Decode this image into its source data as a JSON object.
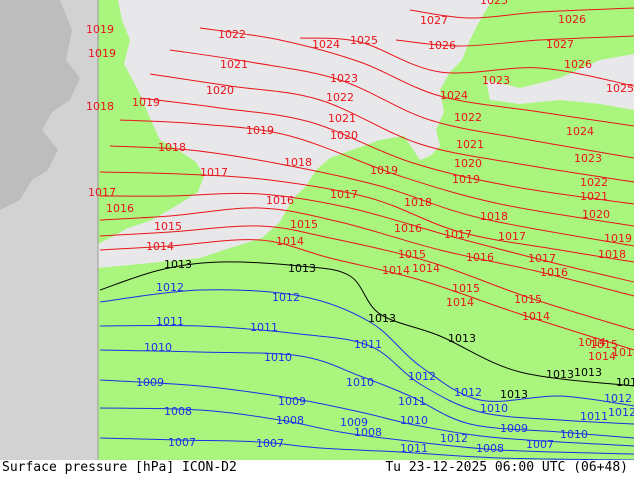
{
  "footer": {
    "left": "Surface pressure [hPa] ICON-D2",
    "right": "Tu 23-12-2025 06:00 UTC (06+48)"
  },
  "colors": {
    "sea": "#e8e8ea",
    "land_in_domain": "#aaf57e",
    "land_outside": "#bdbdbd",
    "sea_outside": "#d2d2d2",
    "isobar_high": "#e8141a",
    "isobar_low": "#1f2ee8",
    "isobar_1013": "#000000"
  },
  "isobars": [
    {
      "value": "1027",
      "color": "red"
    },
    {
      "value": "1026",
      "color": "red"
    },
    {
      "value": "1025",
      "color": "red"
    },
    {
      "value": "1024",
      "color": "red"
    },
    {
      "value": "1023",
      "color": "red"
    },
    {
      "value": "1022",
      "color": "red"
    },
    {
      "value": "1021",
      "color": "red"
    },
    {
      "value": "1020",
      "color": "red"
    },
    {
      "value": "1019",
      "color": "red"
    },
    {
      "value": "1018",
      "color": "red"
    },
    {
      "value": "1017",
      "color": "red"
    },
    {
      "value": "1016",
      "color": "red"
    },
    {
      "value": "1015",
      "color": "red"
    },
    {
      "value": "1014",
      "color": "red"
    },
    {
      "value": "1013",
      "color": "black"
    },
    {
      "value": "1012",
      "color": "blue"
    },
    {
      "value": "1011",
      "color": "blue"
    },
    {
      "value": "1010",
      "color": "blue"
    },
    {
      "value": "1009",
      "color": "blue"
    },
    {
      "value": "1008",
      "color": "blue"
    },
    {
      "value": "1007",
      "color": "blue"
    }
  ],
  "labels": [
    {
      "text": "1019",
      "color": "red"
    },
    {
      "text": "1019",
      "color": "red"
    },
    {
      "text": "1018",
      "color": "red"
    },
    {
      "text": "1019",
      "color": "red"
    },
    {
      "text": "1017",
      "color": "red"
    },
    {
      "text": "1016",
      "color": "red"
    },
    {
      "text": "1015",
      "color": "red"
    },
    {
      "text": "1014",
      "color": "red"
    },
    {
      "text": "1022",
      "color": "red"
    },
    {
      "text": "1021",
      "color": "red"
    },
    {
      "text": "1020",
      "color": "red"
    },
    {
      "text": "1019",
      "color": "red"
    },
    {
      "text": "1018",
      "color": "red"
    },
    {
      "text": "1017",
      "color": "red"
    },
    {
      "text": "1016",
      "color": "red"
    },
    {
      "text": "1015",
      "color": "red"
    },
    {
      "text": "1014",
      "color": "red"
    },
    {
      "text": "1024",
      "color": "red"
    },
    {
      "text": "1025",
      "color": "red"
    },
    {
      "text": "1023",
      "color": "red"
    },
    {
      "text": "1022",
      "color": "red"
    },
    {
      "text": "1021",
      "color": "red"
    },
    {
      "text": "1020",
      "color": "red"
    },
    {
      "text": "1018",
      "color": "red"
    },
    {
      "text": "1017",
      "color": "red"
    },
    {
      "text": "1019",
      "color": "red"
    },
    {
      "text": "1018",
      "color": "red"
    },
    {
      "text": "1016",
      "color": "red"
    },
    {
      "text": "1017",
      "color": "red"
    },
    {
      "text": "1027",
      "color": "red"
    },
    {
      "text": "1026",
      "color": "red"
    },
    {
      "text": "1025",
      "color": "red"
    },
    {
      "text": "1024",
      "color": "red"
    },
    {
      "text": "1023",
      "color": "red"
    },
    {
      "text": "1022",
      "color": "red"
    },
    {
      "text": "1021",
      "color": "red"
    },
    {
      "text": "1020",
      "color": "red"
    },
    {
      "text": "1019",
      "color": "red"
    },
    {
      "text": "1018",
      "color": "red"
    },
    {
      "text": "1017",
      "color": "red"
    },
    {
      "text": "1016",
      "color": "red"
    },
    {
      "text": "1015",
      "color": "red"
    },
    {
      "text": "1014",
      "color": "red"
    },
    {
      "text": "1026",
      "color": "red"
    },
    {
      "text": "1027",
      "color": "red"
    },
    {
      "text": "1026",
      "color": "red"
    },
    {
      "text": "1025",
      "color": "red"
    },
    {
      "text": "1024",
      "color": "red"
    },
    {
      "text": "1023",
      "color": "red"
    },
    {
      "text": "1022",
      "color": "red"
    },
    {
      "text": "1021",
      "color": "red"
    },
    {
      "text": "1020",
      "color": "red"
    },
    {
      "text": "1019",
      "color": "red"
    },
    {
      "text": "1018",
      "color": "red"
    },
    {
      "text": "1017",
      "color": "red"
    },
    {
      "text": "1016",
      "color": "red"
    },
    {
      "text": "1015",
      "color": "red"
    },
    {
      "text": "1014",
      "color": "red"
    },
    {
      "text": "1014",
      "color": "red"
    },
    {
      "text": "1015",
      "color": "red"
    },
    {
      "text": "1014",
      "color": "red"
    },
    {
      "text": "1015",
      "color": "red"
    },
    {
      "text": "1014",
      "color": "red"
    },
    {
      "text": "1014",
      "color": "red"
    },
    {
      "text": "1013",
      "color": "black"
    },
    {
      "text": "1013",
      "color": "black"
    },
    {
      "text": "1013",
      "color": "black"
    },
    {
      "text": "1013",
      "color": "black"
    },
    {
      "text": "1013",
      "color": "black"
    },
    {
      "text": "1013",
      "color": "black"
    },
    {
      "text": "1012",
      "color": "blue"
    },
    {
      "text": "1012",
      "color": "blue"
    },
    {
      "text": "1011",
      "color": "blue"
    },
    {
      "text": "1011",
      "color": "blue"
    },
    {
      "text": "1011",
      "color": "blue"
    },
    {
      "text": "1012",
      "color": "blue"
    },
    {
      "text": "1010",
      "color": "blue"
    },
    {
      "text": "1010",
      "color": "blue"
    },
    {
      "text": "1010",
      "color": "blue"
    },
    {
      "text": "1009",
      "color": "blue"
    },
    {
      "text": "1009",
      "color": "blue"
    },
    {
      "text": "1009",
      "color": "blue"
    },
    {
      "text": "1008",
      "color": "blue"
    },
    {
      "text": "1008",
      "color": "blue"
    },
    {
      "text": "1008",
      "color": "blue"
    },
    {
      "text": "1007",
      "color": "blue"
    },
    {
      "text": "1007",
      "color": "blue"
    },
    {
      "text": "1010",
      "color": "blue"
    },
    {
      "text": "1011",
      "color": "blue"
    },
    {
      "text": "1012",
      "color": "blue"
    },
    {
      "text": "1011",
      "color": "blue"
    },
    {
      "text": "1012",
      "color": "blue"
    },
    {
      "text": "1010",
      "color": "blue"
    },
    {
      "text": "1009",
      "color": "blue"
    },
    {
      "text": "1008",
      "color": "blue"
    },
    {
      "text": "1007",
      "color": "blue"
    },
    {
      "text": "1010",
      "color": "blue"
    },
    {
      "text": "1011",
      "color": "blue"
    },
    {
      "text": "1012",
      "color": "blue"
    },
    {
      "text": "1013",
      "color": "black"
    },
    {
      "text": "1014",
      "color": "red"
    },
    {
      "text": "1013",
      "color": "black"
    },
    {
      "text": "1012",
      "color": "blue"
    }
  ]
}
